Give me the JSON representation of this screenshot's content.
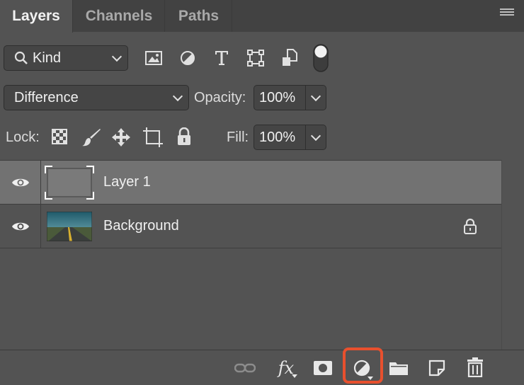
{
  "tabs": [
    {
      "label": "Layers",
      "active": true
    },
    {
      "label": "Channels",
      "active": false
    },
    {
      "label": "Paths",
      "active": false
    }
  ],
  "filter": {
    "kind_label": "Kind",
    "icons": [
      "image-filter-icon",
      "adjustment-filter-icon",
      "type-filter-icon",
      "shape-filter-icon",
      "smart-object-filter-icon",
      "filter-toggle-icon"
    ]
  },
  "blend": {
    "mode": "Difference",
    "opacity_label": "Opacity:",
    "opacity_value": "100%"
  },
  "lock": {
    "label": "Lock:",
    "fill_label": "Fill:",
    "fill_value": "100%",
    "icons": [
      "lock-transparent-pixels-icon",
      "lock-image-pixels-icon",
      "lock-position-icon",
      "prevent-autonest-icon",
      "lock-all-icon"
    ]
  },
  "layers": [
    {
      "name": "Layer 1",
      "selected": true,
      "visible": true,
      "locked": false
    },
    {
      "name": "Background",
      "selected": false,
      "visible": true,
      "locked": true
    }
  ],
  "footer": {
    "fx_label": "fx",
    "icons": [
      "link-layers-icon",
      "fx-icon",
      "add-mask-icon",
      "new-adjustment-layer-icon",
      "new-group-icon",
      "new-layer-icon",
      "delete-layer-icon"
    ],
    "highlighted": "new-adjustment-layer-icon"
  },
  "colors": {
    "panel": "#535353",
    "tabbar": "#424242",
    "selected_row": "#727272",
    "highlight": "#e8502e"
  }
}
